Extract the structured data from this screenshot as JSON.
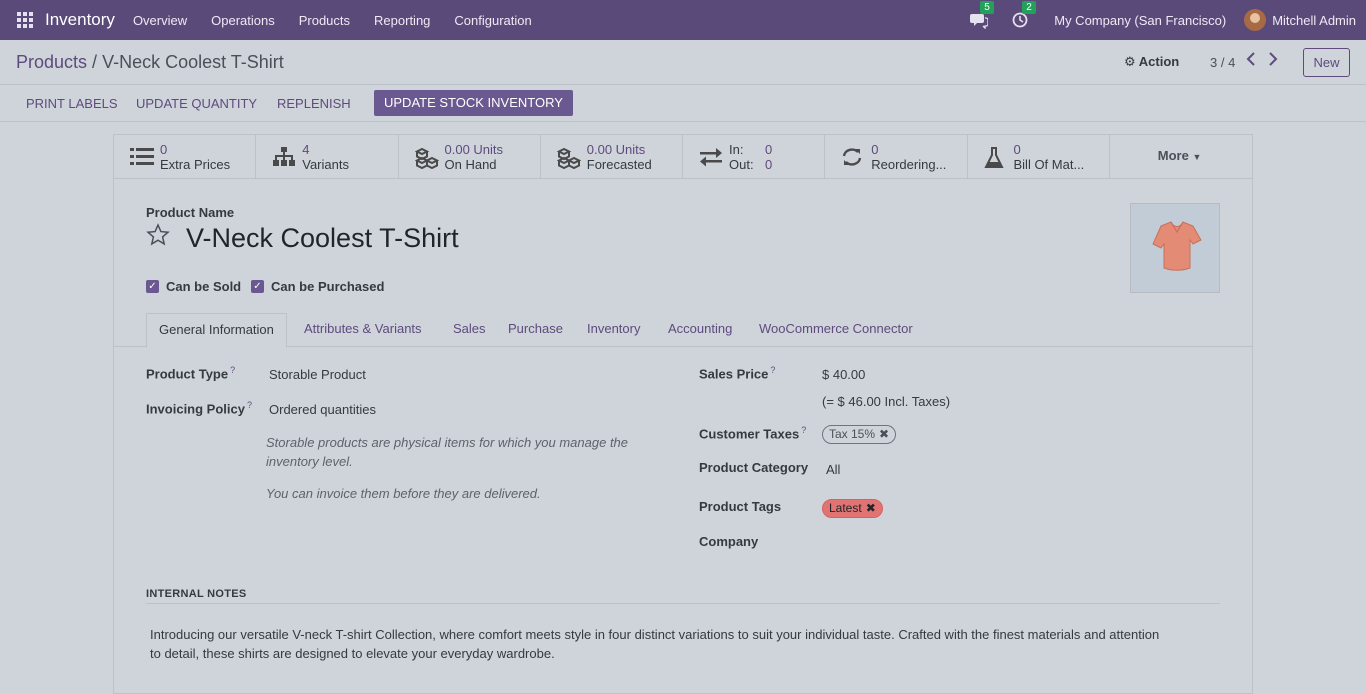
{
  "navbar": {
    "app_name": "Inventory",
    "menu": [
      "Overview",
      "Operations",
      "Products",
      "Reporting",
      "Configuration"
    ],
    "messages_count": "5",
    "activities_count": "2",
    "company": "My Company (San Francisco)",
    "user": "Mitchell Admin"
  },
  "control_panel": {
    "breadcrumb_parent": "Products",
    "breadcrumb_sep": " / ",
    "breadcrumb_current": "V-Neck Coolest T-Shirt",
    "action_label": "Action",
    "pager": "3 / 4",
    "new_label": "New"
  },
  "statusbar": {
    "print_labels": "Print Labels",
    "update_quantity": "Update Quantity",
    "replenish": "Replenish",
    "update_stock": "Update Stock Inventory"
  },
  "smart_buttons": {
    "extra_prices": {
      "value": "0",
      "label": "Extra Prices",
      "icon": "list-icon"
    },
    "variants": {
      "value": "4",
      "label": "Variants",
      "icon": "sitemap-icon"
    },
    "on_hand": {
      "value": "0.00 Units",
      "label": "On Hand",
      "icon": "cubes-icon"
    },
    "forecasted": {
      "value": "0.00 Units",
      "label": "Forecasted",
      "icon": "cubes-icon"
    },
    "in_out": {
      "in_label": "In:",
      "in_value": "0",
      "out_label": "Out:",
      "out_value": "0",
      "icon": "exchange-icon"
    },
    "reordering": {
      "value": "0",
      "label": "Reordering...",
      "icon": "refresh-icon"
    },
    "bom": {
      "value": "0",
      "label": "Bill Of Mat...",
      "icon": "flask-icon"
    },
    "more": "More"
  },
  "product": {
    "name_label": "Product Name",
    "name": "V-Neck Coolest T-Shirt",
    "can_be_sold": "Can be Sold",
    "can_be_purchased": "Can be Purchased"
  },
  "tabs": [
    "General Information",
    "Attributes & Variants",
    "Sales",
    "Purchase",
    "Inventory",
    "Accounting",
    "WooCommerce Connector"
  ],
  "general": {
    "product_type_label": "Product Type",
    "product_type": "Storable Product",
    "invoicing_policy_label": "Invoicing Policy",
    "invoicing_policy": "Ordered quantities",
    "help_storable": "Storable products are physical items for which you manage the inventory level.",
    "help_invoice": "You can invoice them before they are delivered.",
    "sales_price_label": "Sales Price",
    "sales_price": "$ 40.00",
    "incl_taxes": "(= $ 46.00 Incl. Taxes)",
    "customer_taxes_label": "Customer Taxes",
    "customer_tax": "Tax 15%",
    "product_category_label": "Product Category",
    "product_category": "All",
    "product_tags_label": "Product Tags",
    "product_tag": "Latest",
    "company_label": "Company"
  },
  "notes": {
    "title": "INTERNAL NOTES",
    "text": "Introducing our versatile V-neck T-shirt Collection, where comfort meets style in four distinct variations to suit your individual taste. Crafted with the finest materials and attention to detail, these shirts are designed to elevate your everyday wardrobe."
  },
  "colors": {
    "navbar": "#5a4a7a",
    "primary": "#6a5890",
    "tag_latest": "#e17373"
  }
}
